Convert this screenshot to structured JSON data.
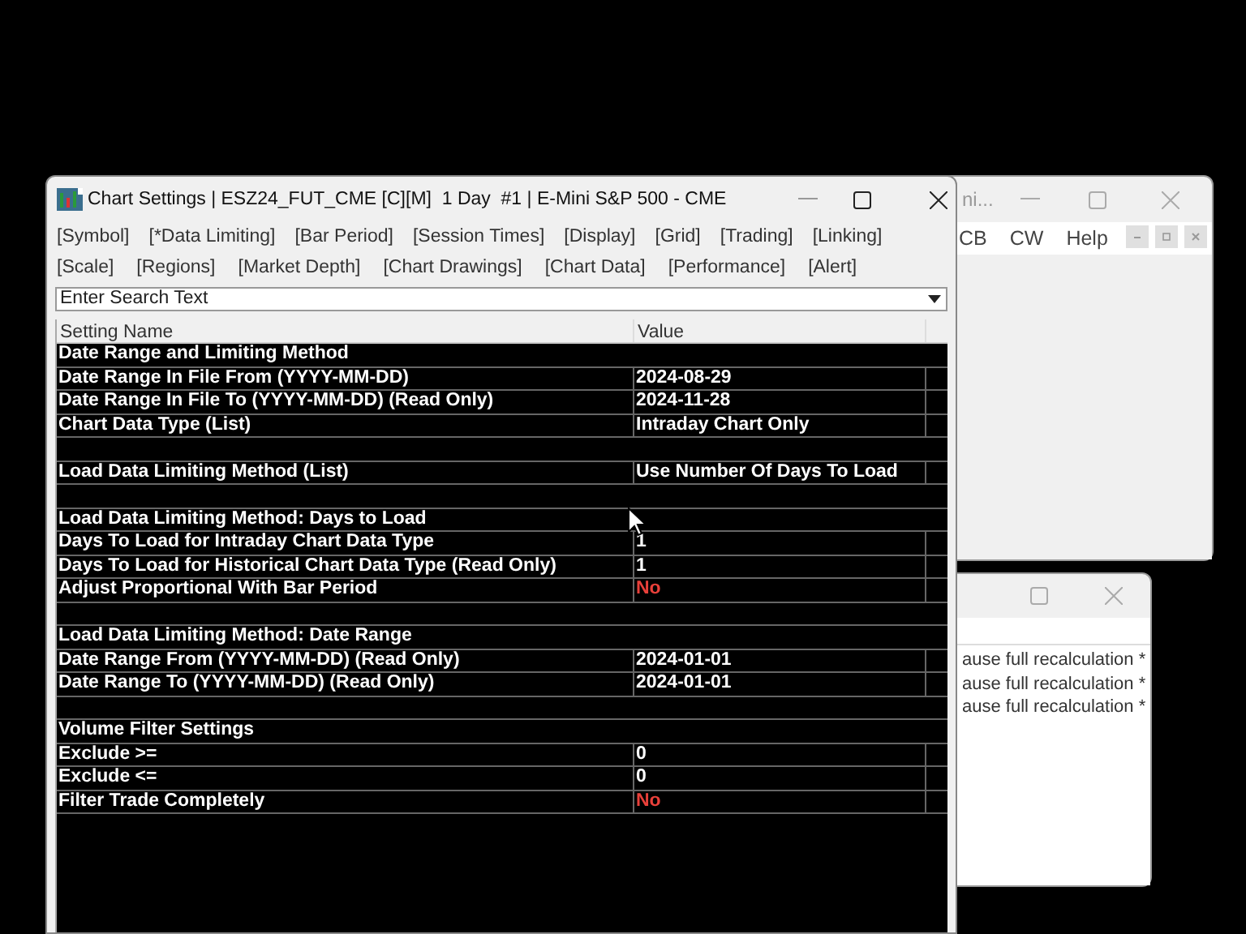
{
  "back_window_1": {
    "title": "ni...",
    "menu": [
      "CB",
      "CW",
      "Help"
    ]
  },
  "back_window_2": {
    "lines": [
      "ause full recalculation *",
      "ause full recalculation *",
      "ause full recalculation *"
    ]
  },
  "window": {
    "title": "Chart Settings | ESZ24_FUT_CME [C][M]  1 Day  #1 | E-Mini S&P 500 - CME"
  },
  "tabs": [
    [
      {
        "label": "[Symbol]"
      },
      {
        "label": "[*Data Limiting]"
      },
      {
        "label": "[Bar Period]"
      },
      {
        "label": "[Session Times]"
      },
      {
        "label": "[Display]"
      },
      {
        "label": "[Grid]"
      },
      {
        "label": "[Trading]"
      },
      {
        "label": "[Linking]"
      }
    ],
    [
      {
        "label": "[Scale]"
      },
      {
        "label": "[Regions]"
      },
      {
        "label": "[Market Depth]"
      },
      {
        "label": "[Chart Drawings]"
      },
      {
        "label": "[Chart Data]"
      },
      {
        "label": "[Performance]"
      },
      {
        "label": "[Alert]"
      }
    ]
  ],
  "search": {
    "placeholder": "Enter Search Text"
  },
  "table": {
    "columns": [
      "Setting Name",
      "Value"
    ],
    "rows": [
      {
        "kind": "section",
        "name": "Date Range and Limiting Method"
      },
      {
        "kind": "setting",
        "name": "Date Range In File From (YYYY-MM-DD)",
        "value": "2024-08-29"
      },
      {
        "kind": "setting",
        "name": "Date Range In File To (YYYY-MM-DD) (Read Only)",
        "value": "2024-11-28"
      },
      {
        "kind": "setting",
        "name": "Chart Data Type (List)",
        "value": "Intraday Chart Only"
      },
      {
        "kind": "blank"
      },
      {
        "kind": "setting",
        "name": "Load Data Limiting Method (List)",
        "value": "Use Number Of Days To Load"
      },
      {
        "kind": "blank"
      },
      {
        "kind": "section",
        "name": "Load Data Limiting Method: Days to Load"
      },
      {
        "kind": "setting",
        "name": "Days To Load for Intraday Chart Data Type",
        "value": "1"
      },
      {
        "kind": "setting",
        "name": "Days To Load for Historical Chart Data Type (Read Only)",
        "value": "1"
      },
      {
        "kind": "toggle",
        "name": "Adjust Proportional With Bar Period",
        "value": "No"
      },
      {
        "kind": "blank"
      },
      {
        "kind": "section",
        "name": "Load Data Limiting Method: Date Range"
      },
      {
        "kind": "setting",
        "name": "Date Range From (YYYY-MM-DD) (Read Only)",
        "value": "2024-01-01"
      },
      {
        "kind": "setting",
        "name": "Date Range To (YYYY-MM-DD) (Read Only)",
        "value": "2024-01-01"
      },
      {
        "kind": "blank"
      },
      {
        "kind": "section",
        "name": "Volume Filter Settings"
      },
      {
        "kind": "setting",
        "name": "Exclude >=",
        "value": "0"
      },
      {
        "kind": "setting",
        "name": "Exclude <=",
        "value": "0"
      },
      {
        "kind": "toggle",
        "name": "Filter Trade Completely",
        "value": "No"
      }
    ]
  }
}
